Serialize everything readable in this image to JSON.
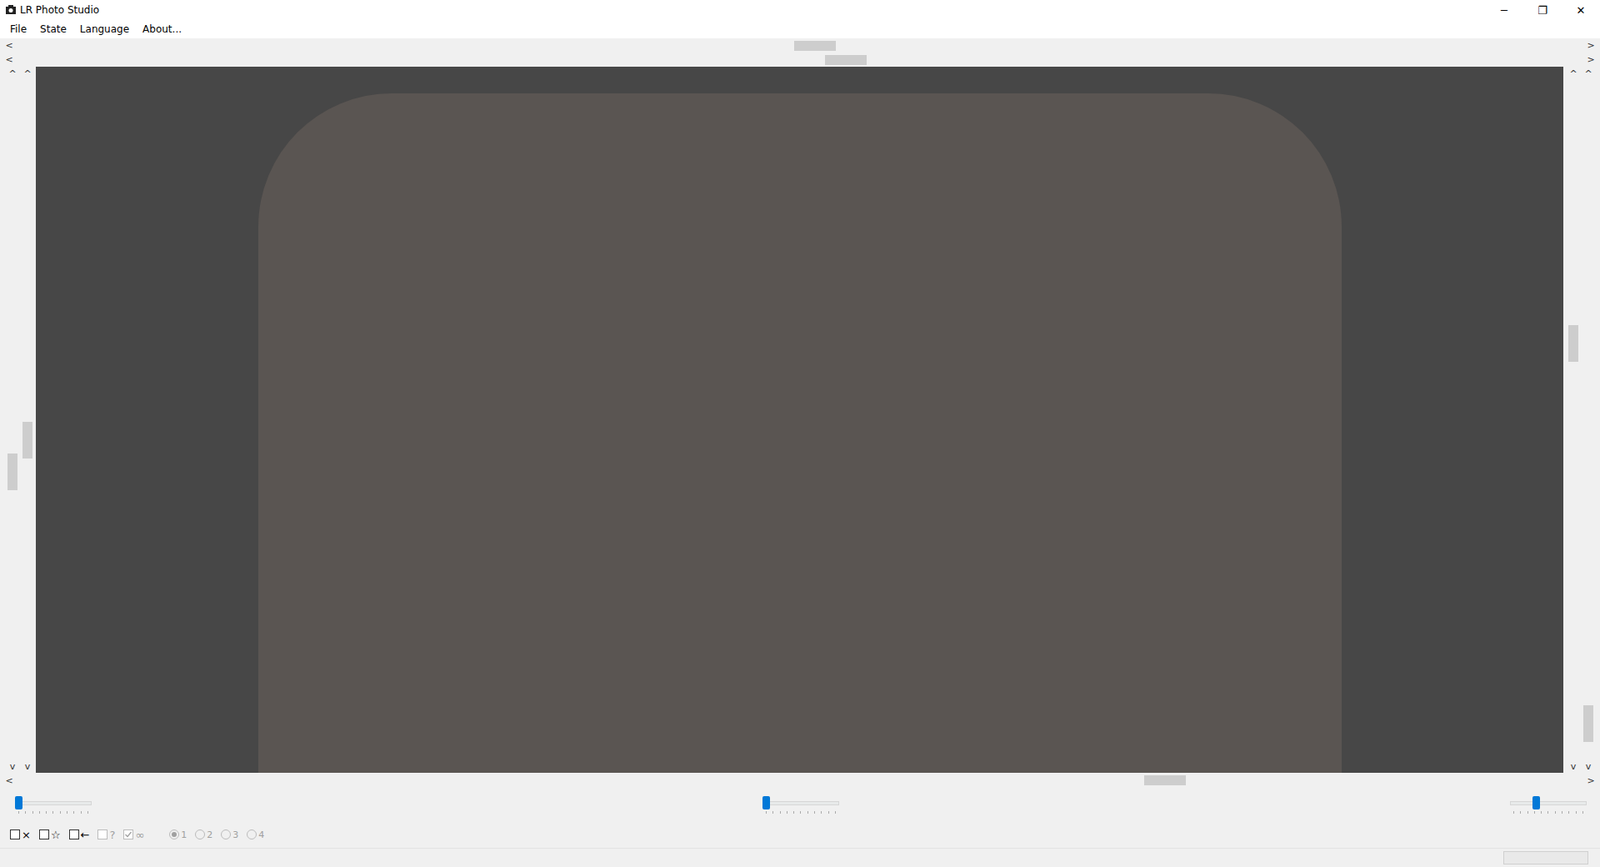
{
  "window": {
    "title": "LR Photo Studio",
    "controls": [
      "─",
      "❐",
      "✕"
    ]
  },
  "menu": [
    "File",
    "State",
    "Language",
    "About..."
  ],
  "arrows": {
    "left": "<",
    "right": ">",
    "up": "^",
    "down": "v"
  },
  "scrollbars": {
    "top": [
      {
        "level": 0.51
      },
      {
        "level": 0.53
      }
    ],
    "left": [
      {
        "level": 0.58
      },
      {
        "level": 0.53
      }
    ],
    "right": [
      {
        "level": 0.38
      },
      {
        "level": 0.97
      }
    ],
    "bottom": {
      "level": 0.74
    }
  },
  "sliders": [
    {
      "level": 0
    },
    {
      "level": 0
    },
    {
      "level": 0.32
    }
  ],
  "toggles": [
    {
      "label": "×",
      "checked": false,
      "disabled": false
    },
    {
      "label": "☆",
      "checked": false,
      "disabled": false
    },
    {
      "label": "←",
      "checked": false,
      "disabled": false
    },
    {
      "label": "?",
      "checked": false,
      "disabled": true
    },
    {
      "label": "∞",
      "checked": true,
      "disabled": true
    }
  ],
  "radios": [
    {
      "label": "1",
      "selected": true,
      "disabled": true
    },
    {
      "label": "2",
      "selected": false,
      "disabled": true
    },
    {
      "label": "3",
      "selected": false,
      "disabled": true
    },
    {
      "label": "4",
      "selected": false,
      "disabled": true
    }
  ]
}
